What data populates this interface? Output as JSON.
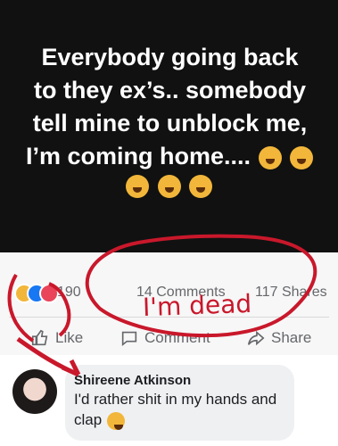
{
  "post": {
    "lines": [
      "Everybody going back",
      "to they ex’s.. somebody",
      "tell mine to unblock me,",
      "I’m coming home...."
    ]
  },
  "reactions": {
    "count": "190",
    "comments": "14 Comments",
    "shares": "117 Shares"
  },
  "actions": {
    "like": "Like",
    "comment": "Comment",
    "share": "Share"
  },
  "comment": {
    "author": "Shireene Atkinson",
    "text": "I'd rather shit in my hands and clap"
  },
  "annotation": {
    "text": "I'm dead",
    "color": "#c9182b"
  },
  "icons": [
    "crying-laughing-emoji",
    "like-reaction-icon",
    "love-reaction-icon",
    "like-thumb-icon",
    "comment-bubble-icon",
    "share-arrow-icon",
    "facepalm-emoji"
  ]
}
